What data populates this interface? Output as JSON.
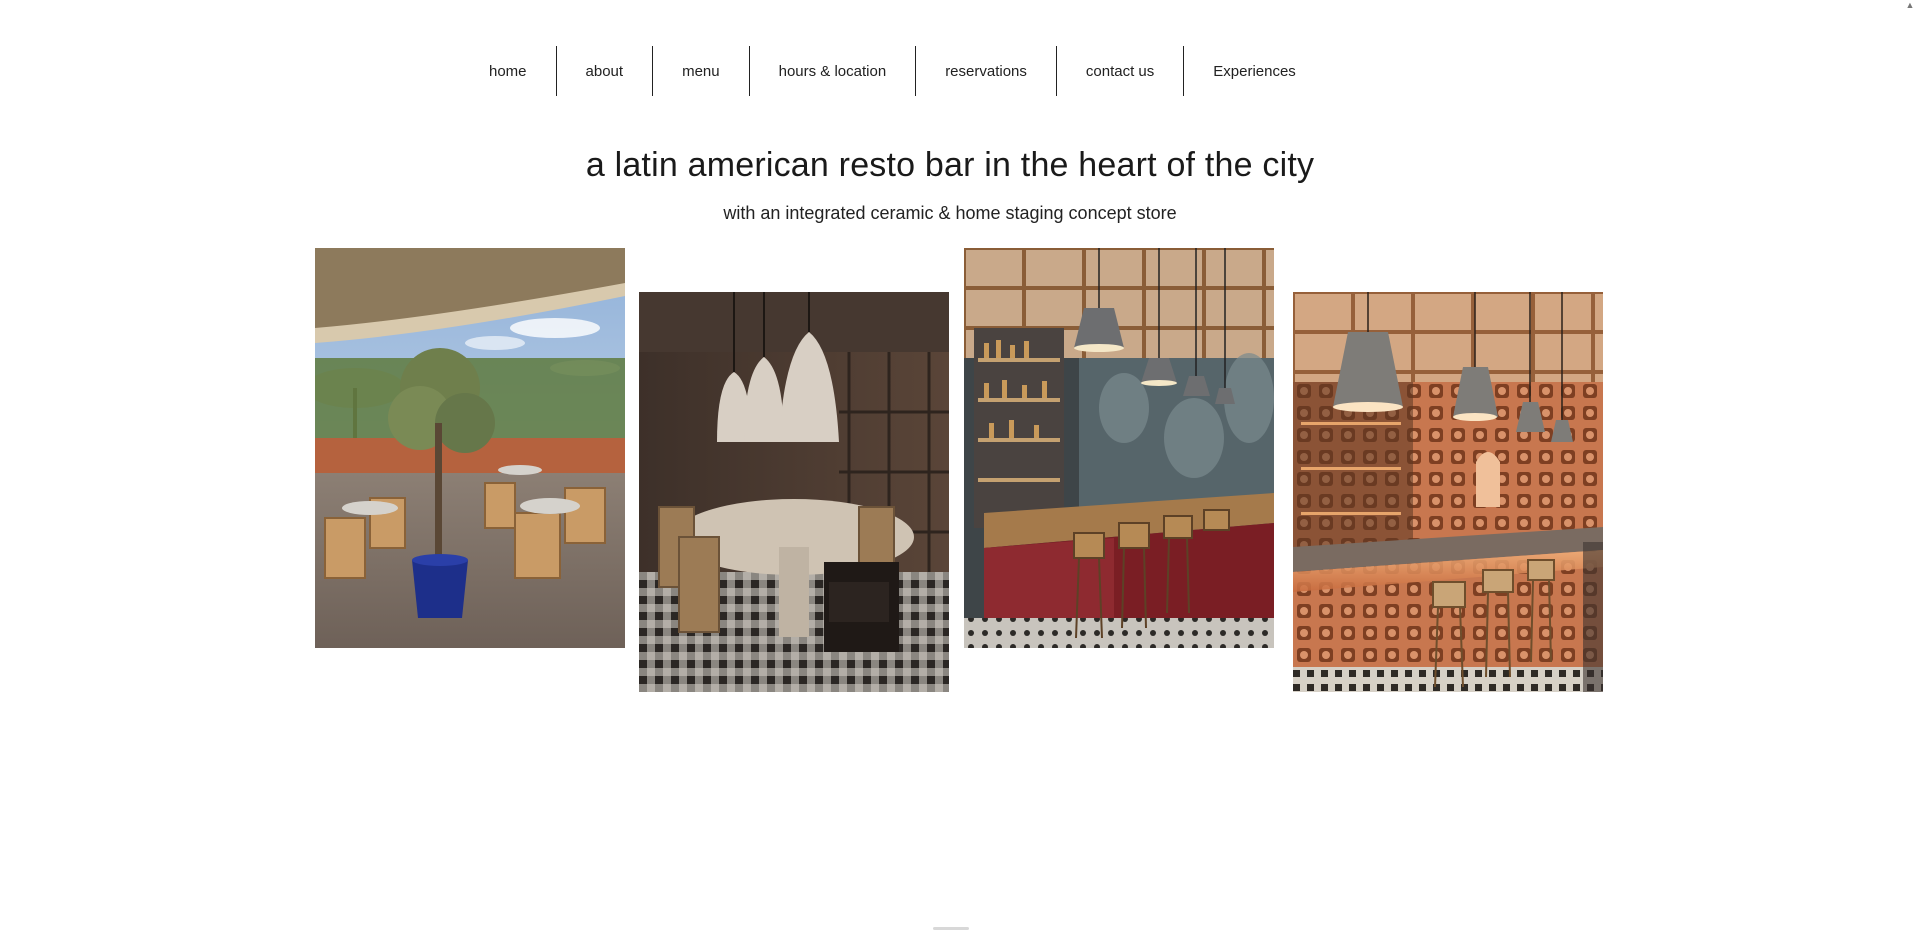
{
  "nav": {
    "items": [
      {
        "label": "home"
      },
      {
        "label": "about"
      },
      {
        "label": "menu"
      },
      {
        "label": "hours & location"
      },
      {
        "label": "reservations"
      },
      {
        "label": "contact us"
      },
      {
        "label": "Experiences"
      }
    ]
  },
  "hero": {
    "headline": "a latin american resto bar in the heart of the city",
    "subheadline": "with an integrated ceramic & home staging concept store"
  },
  "gallery": {
    "photos": [
      {
        "icon": "rooftop-terrace-photo"
      },
      {
        "icon": "private-dining-room-photo"
      },
      {
        "icon": "bar-counter-photo"
      },
      {
        "icon": "terracotta-bar-photo"
      }
    ]
  },
  "colors": {
    "text": "#1a1a1a",
    "background": "#ffffff",
    "nav_divider": "#222222"
  }
}
